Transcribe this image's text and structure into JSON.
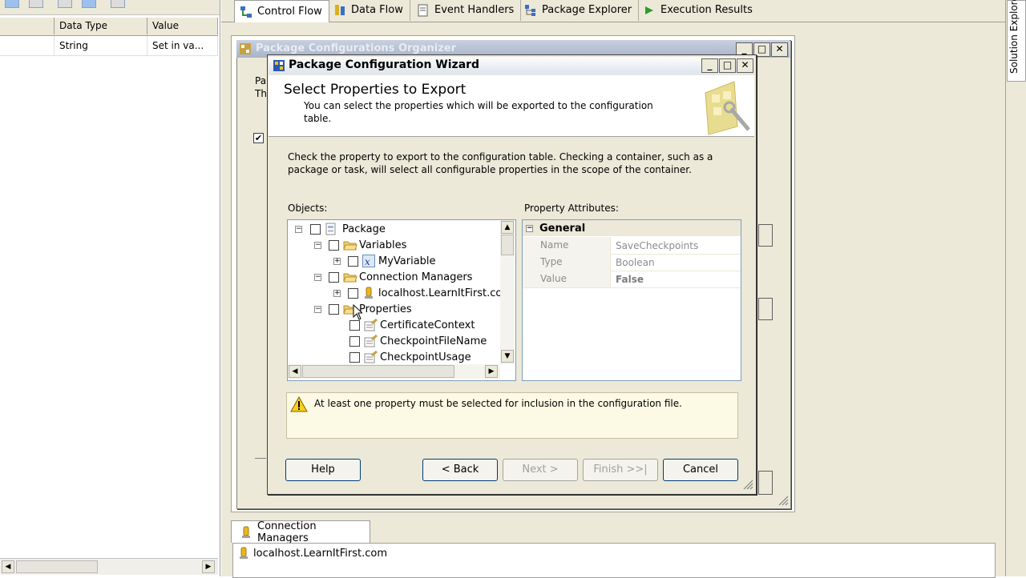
{
  "variables_panel": {
    "columns": [
      "Data Type",
      "Value"
    ],
    "rows": [
      {
        "data_type": "String",
        "value": "Set in va..."
      }
    ]
  },
  "designer": {
    "tabs": [
      {
        "label": "Control Flow",
        "active": true
      },
      {
        "label": "Data Flow",
        "active": false
      },
      {
        "label": "Event Handlers",
        "active": false
      },
      {
        "label": "Package Explorer",
        "active": false
      },
      {
        "label": "Execution Results",
        "active": false
      }
    ],
    "connection_managers_tab": "Connection Managers",
    "connection_managers": [
      "localhost.LearnItFirst.com"
    ],
    "side_panel": "Solution Explorer"
  },
  "organizer": {
    "title": "Package Configurations Organizer",
    "text_fragments": [
      "Pa",
      "Th"
    ],
    "checkbox_checked": true
  },
  "wizard": {
    "title": "Package Configuration Wizard",
    "heading": "Select Properties to Export",
    "subheading": "You can select the properties which will be exported to the configuration table.",
    "instructions": "Check the property to export to the configuration table. Checking a container, such as a package or task, will select all configurable properties in the scope of the container.",
    "objects_label": "Objects:",
    "property_attributes_label": "Property Attributes:",
    "tree": [
      {
        "label": "Package",
        "expander": "minus",
        "icon": "package-icon"
      },
      {
        "label": "Variables",
        "expander": "minus",
        "icon": "folder-icon"
      },
      {
        "label": "MyVariable",
        "expander": "plus",
        "icon": "variable-icon"
      },
      {
        "label": "Connection Managers",
        "expander": "minus",
        "icon": "folder-icon"
      },
      {
        "label": "localhost.LearnItFirst.com",
        "expander": "plus",
        "icon": "connection-icon"
      },
      {
        "label": "Properties",
        "expander": "minus",
        "icon": "folder-icon"
      },
      {
        "label": "CertificateContext",
        "expander": "",
        "icon": "property-icon"
      },
      {
        "label": "CheckpointFileName",
        "expander": "",
        "icon": "property-icon"
      },
      {
        "label": "CheckpointUsage",
        "expander": "",
        "icon": "property-icon"
      }
    ],
    "property_category": "General",
    "properties": [
      {
        "name": "Name",
        "value": "SaveCheckpoints"
      },
      {
        "name": "Type",
        "value": "Boolean"
      },
      {
        "name": "Value",
        "value": "False"
      }
    ],
    "warning": "At least one property must be selected for inclusion in the configuration file.",
    "buttons": {
      "help": "Help",
      "back": "< Back",
      "next": "Next >",
      "finish": "Finish >>|",
      "cancel": "Cancel"
    }
  }
}
